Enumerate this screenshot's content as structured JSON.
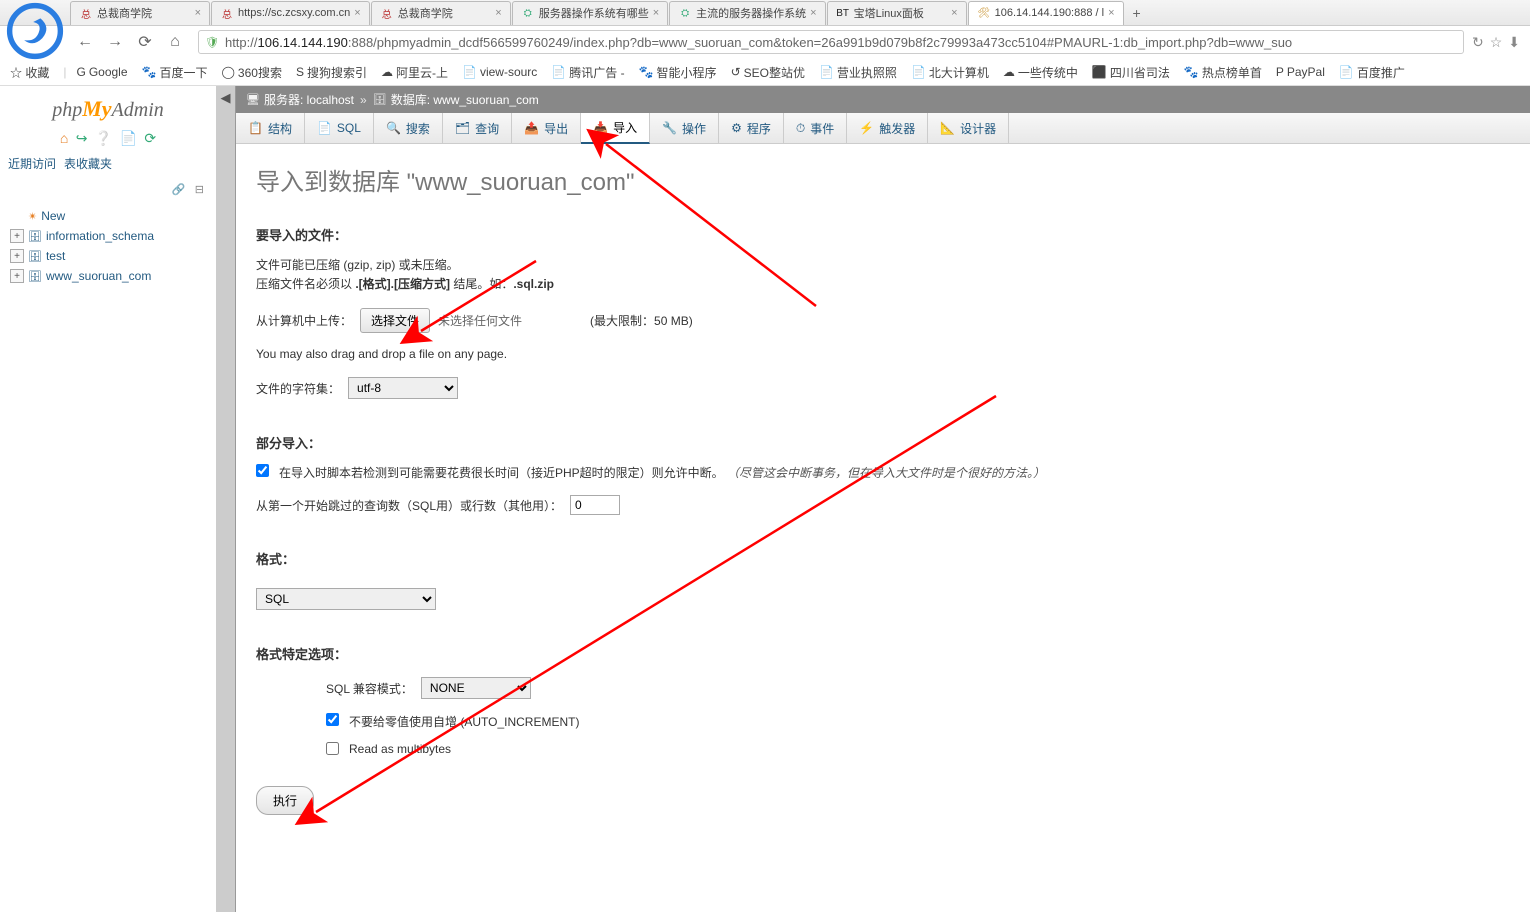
{
  "browser": {
    "tabs": [
      {
        "favicon": "总",
        "favicon_color": "#b33",
        "title": "总裁商学院"
      },
      {
        "favicon": "总",
        "favicon_color": "#b33",
        "title": "https://sc.zcsxy.com.cn"
      },
      {
        "favicon": "总",
        "favicon_color": "#b33",
        "title": "总裁商学院"
      },
      {
        "favicon": "⛭",
        "favicon_color": "#3a7",
        "title": "服务器操作系统有哪些"
      },
      {
        "favicon": "⛭",
        "favicon_color": "#3a7",
        "title": "主流的服务器操作系统"
      },
      {
        "favicon": "BT",
        "favicon_color": "#222",
        "title": "宝塔Linux面板"
      },
      {
        "favicon": "🛠",
        "favicon_color": "#c99433",
        "title": "106.14.144.190:888 / l"
      }
    ],
    "url_prefix": "http://",
    "url_bold": "106.14.144.190",
    "url_rest": ":888/phpmyadmin_dcdf566599760249/index.php?db=www_suoruan_com&token=26a991b9d079b8f2c79993a473cc5104#PMAURL-1:db_import.php?db=www_suo",
    "bookmarks_star": "☆ 收藏",
    "bookmarks": [
      {
        "icon": "G",
        "label": "Google"
      },
      {
        "icon": "🐾",
        "label": "百度一下"
      },
      {
        "icon": "◯",
        "label": "360搜索"
      },
      {
        "icon": "S",
        "label": "搜狗搜索引"
      },
      {
        "icon": "☁",
        "label": "阿里云-上"
      },
      {
        "icon": "📄",
        "label": "view-sourc"
      },
      {
        "icon": "📄",
        "label": "腾讯广告 -"
      },
      {
        "icon": "🐾",
        "label": "智能小程序"
      },
      {
        "icon": "↺",
        "label": "SEO整站优"
      },
      {
        "icon": "📄",
        "label": "营业执照照"
      },
      {
        "icon": "📄",
        "label": "北大计算机"
      },
      {
        "icon": "☁",
        "label": "一些传统中"
      },
      {
        "icon": "⬛",
        "label": "四川省司法"
      },
      {
        "icon": "🐾",
        "label": "热点榜单首"
      },
      {
        "icon": "P",
        "label": "PayPal"
      },
      {
        "icon": "📄",
        "label": "百度推广"
      }
    ]
  },
  "sidebar": {
    "recent_label": "近期访问",
    "favorites_label": "表收藏夹",
    "dbs": [
      {
        "name": "New",
        "expandable": false,
        "new": true
      },
      {
        "name": "information_schema",
        "expandable": true
      },
      {
        "name": "test",
        "expandable": true
      },
      {
        "name": "www_suoruan_com",
        "expandable": true
      }
    ]
  },
  "breadcrumb": {
    "server_label": "服务器:",
    "server_value": "localhost",
    "db_label": "数据库:",
    "db_value": "www_suoruan_com"
  },
  "tabs": [
    {
      "icon": "📋",
      "label": "结构"
    },
    {
      "icon": "📄",
      "label": "SQL"
    },
    {
      "icon": "🔍",
      "label": "搜索"
    },
    {
      "icon": "🗂",
      "label": "查询"
    },
    {
      "icon": "📤",
      "label": "导出"
    },
    {
      "icon": "📥",
      "label": "导入"
    },
    {
      "icon": "🔧",
      "label": "操作"
    },
    {
      "icon": "⚙",
      "label": "程序"
    },
    {
      "icon": "⏱",
      "label": "事件"
    },
    {
      "icon": "⚡",
      "label": "触发器"
    },
    {
      "icon": "📐",
      "label": "设计器"
    }
  ],
  "active_tab_index": 5,
  "page": {
    "title": "导入到数据库 \"www_suoruan_com\"",
    "file_section": "要导入的文件：",
    "compress_hint1": "文件可能已压缩 (gzip, zip) 或未压缩。",
    "compress_hint2_pre": "压缩文件名必须以 ",
    "compress_hint2_bold": ".[格式].[压缩方式]",
    "compress_hint2_post": " 结尾。如：",
    "compress_hint2_example": ".sql.zip",
    "upload_label": "从计算机中上传：",
    "choose_file_btn": "选择文件",
    "no_file": "未选择任何文件",
    "max_label": "(最大限制：50 MB)",
    "dragdrop": "You may also drag and drop a file on any page.",
    "charset_label": "文件的字符集：",
    "charset_value": "utf-8",
    "partial_section": "部分导入：",
    "interrupt_label": "在导入时脚本若检测到可能需要花费很长时间（接近PHP超时的限定）则允许中断。",
    "interrupt_note": "（尽管这会中断事务，但在导入大文件时是个很好的方法。）",
    "skip_label": "从第一个开始跳过的查询数（SQL用）或行数（其他用）：",
    "skip_value": "0",
    "format_section": "格式：",
    "format_value": "SQL",
    "options_section": "格式特定选项：",
    "compat_label": "SQL 兼容模式：",
    "compat_value": "NONE",
    "autoincrement_label": "不要给零值使用自增 (AUTO_INCREMENT)",
    "multibytes_label": "Read as multibytes",
    "submit_btn": "执行"
  }
}
